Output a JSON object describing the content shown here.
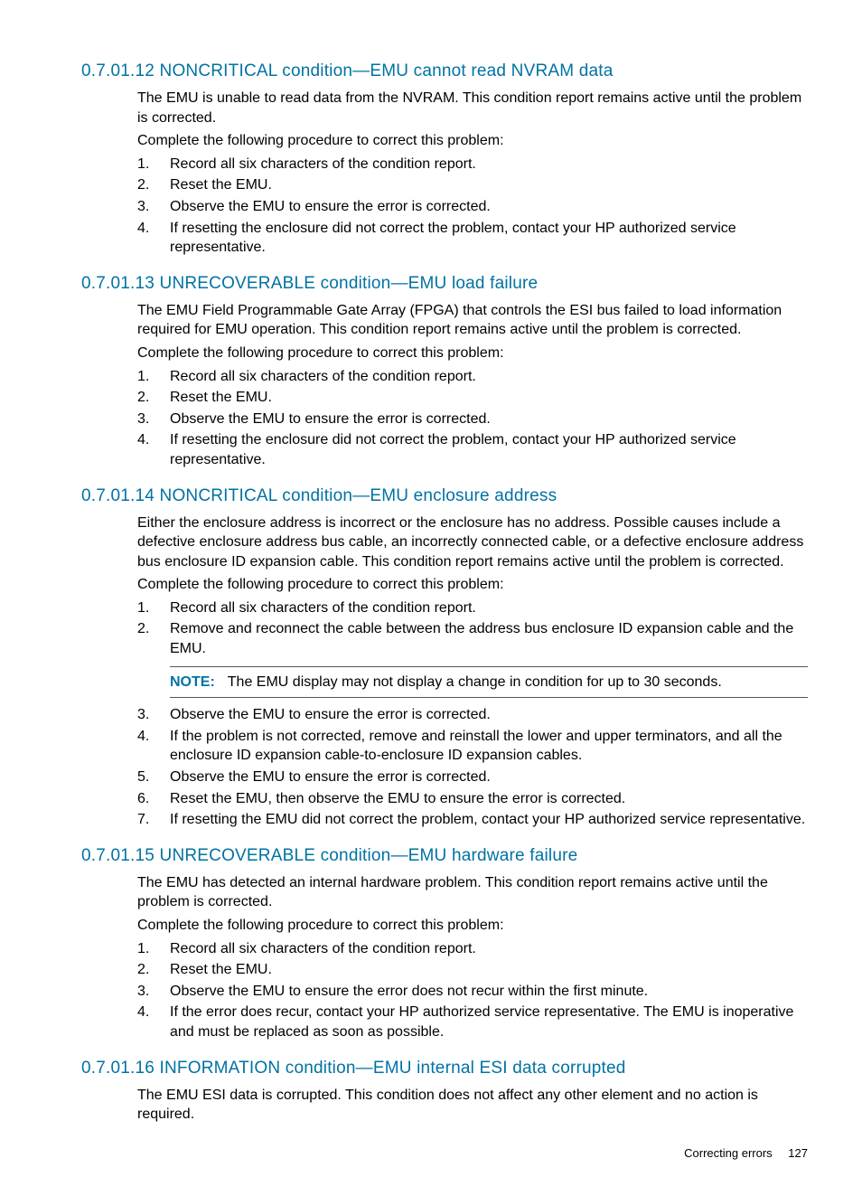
{
  "sections": [
    {
      "heading": "0.7.01.12 NONCRITICAL condition—EMU cannot read NVRAM data",
      "intro": [
        "The EMU is unable to read data from the NVRAM. This condition report remains active until the problem is corrected.",
        "Complete the following procedure to correct this problem:"
      ],
      "steps": [
        "Record all six characters of the condition report.",
        "Reset the EMU.",
        "Observe the EMU to ensure the error is corrected.",
        "If resetting the enclosure did not correct the problem, contact your HP authorized service representative."
      ]
    },
    {
      "heading": "0.7.01.13 UNRECOVERABLE condition—EMU load failure",
      "intro": [
        "The EMU Field Programmable Gate Array (FPGA) that controls the ESI bus failed to load information required for EMU operation. This condition report remains active until the problem is corrected.",
        "Complete the following procedure to correct this problem:"
      ],
      "steps": [
        "Record all six characters of the condition report.",
        "Reset the EMU.",
        "Observe the EMU to ensure the error is corrected.",
        "If resetting the enclosure did not correct the problem, contact your HP authorized service representative."
      ]
    },
    {
      "heading": "0.7.01.14 NONCRITICAL condition—EMU enclosure address",
      "intro": [
        "Either the enclosure address is incorrect or the enclosure has no address. Possible causes include a defective enclosure address bus cable, an incorrectly connected cable, or a defective enclosure address bus enclosure ID expansion cable. This condition report remains active until the problem is corrected.",
        "Complete the following procedure to correct this problem:"
      ],
      "steps1": [
        "Record all six characters of the condition report.",
        "Remove and reconnect the cable between the address bus enclosure ID expansion cable and the EMU."
      ],
      "note_label": "NOTE:",
      "note_text": "The EMU display may not display a change in condition for up to 30 seconds.",
      "steps2": [
        "Observe the EMU to ensure the error is corrected.",
        "If the problem is not corrected, remove and reinstall the lower and upper terminators, and all the enclosure ID expansion cable-to-enclosure ID expansion cables.",
        "Observe the EMU to ensure the error is corrected.",
        "Reset the EMU, then observe the EMU to ensure the error is corrected.",
        "If resetting the EMU did not correct the problem, contact your HP authorized service representative."
      ]
    },
    {
      "heading": "0.7.01.15 UNRECOVERABLE condition—EMU hardware failure",
      "intro": [
        "The EMU has detected an internal hardware problem. This condition report remains active until the problem is corrected.",
        "Complete the following procedure to correct this problem:"
      ],
      "steps": [
        "Record all six characters of the condition report.",
        "Reset the EMU.",
        "Observe the EMU to ensure the error does not recur within the first minute.",
        "If the error does recur, contact your HP authorized service representative. The EMU is inoperative and must be replaced as soon as possible."
      ]
    },
    {
      "heading": "0.7.01.16 INFORMATION condition—EMU internal ESI data corrupted",
      "intro": [
        "The EMU ESI data is corrupted. This condition does not affect any other element and no action is required."
      ]
    }
  ],
  "footer": {
    "label": "Correcting errors",
    "page": "127"
  }
}
